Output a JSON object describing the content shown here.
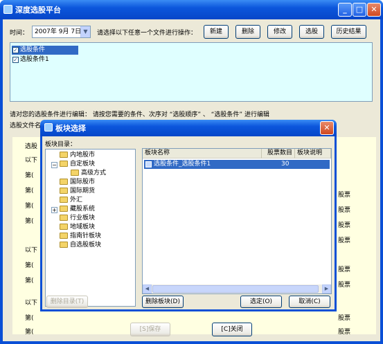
{
  "main": {
    "title": "深度选股平台",
    "time_label": "时间：",
    "date_value": "2007年 9月 7日",
    "instruction": "请选择以下任意一个文件进行操作：",
    "buttons": {
      "new": "新建",
      "delete": "删除",
      "modify": "修改",
      "select": "选股",
      "history": "历史结果"
    },
    "files": [
      "选股条件",
      "选股条件1"
    ],
    "edit_hint": "请对您的选股条件进行编辑： 请按您需要的条件、次序对 “选股顺序” 、 “选股条件” 进行编辑",
    "file_label_partial": "选股文件名",
    "bottom_buttons": {
      "save": "[S]保存",
      "close": "[C]关闭"
    },
    "bg_labels": {
      "sel_partial": "选股",
      "below": "以下",
      "ordinal": "第(",
      "stock": "股票"
    }
  },
  "dialog": {
    "title": "板块选择",
    "dir_label": "板块目录：",
    "tree": [
      {
        "label": "内地股市",
        "expander": ""
      },
      {
        "label": "自定板块",
        "expander": "−"
      },
      {
        "label": "高级方式",
        "expander": ""
      },
      {
        "label": "国际股市",
        "expander": ""
      },
      {
        "label": "国际期货",
        "expander": ""
      },
      {
        "label": "外汇",
        "expander": ""
      },
      {
        "label": "藏股系统",
        "expander": "+"
      },
      {
        "label": "行业板块",
        "expander": ""
      },
      {
        "label": "地域板块",
        "expander": ""
      },
      {
        "label": "指南针板块",
        "expander": ""
      },
      {
        "label": "自选股板块",
        "expander": ""
      }
    ],
    "columns": [
      "板块名称",
      "股票数目",
      "板块说明"
    ],
    "rows": [
      {
        "name": "选股条件_选股条件1",
        "count": "30",
        "desc": ""
      }
    ],
    "buttons": {
      "del_dir": "删除目录(T)",
      "del_block": "删除板块(D)",
      "ok": "选定(O)",
      "cancel": "取消(C)"
    }
  },
  "colors": {
    "titlebar": "#0a4fd6",
    "list_bg": "#dfffff",
    "highlight": "#316ac5",
    "yellow_panel": "#ffffe1"
  }
}
